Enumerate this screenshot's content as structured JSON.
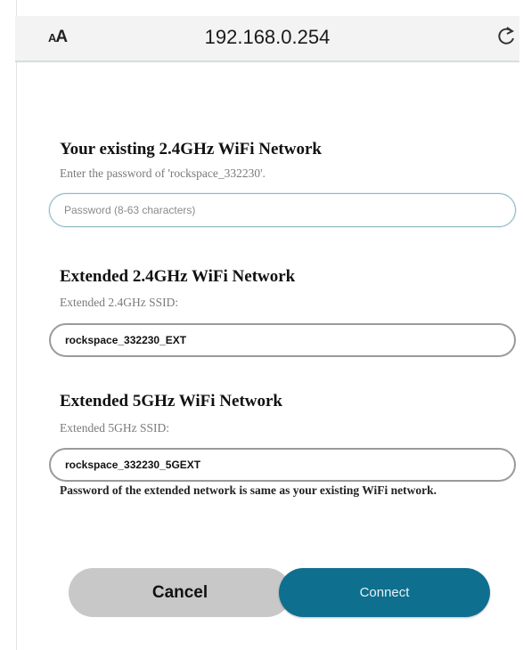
{
  "browser": {
    "text_size_label_small": "A",
    "text_size_label_large": "A",
    "url": "192.168.0.254",
    "reload_icon": "reload-icon"
  },
  "existing_network": {
    "title": "Your existing 2.4GHz WiFi Network",
    "hint": "Enter the password of 'rockspace_332230'.",
    "password_placeholder": "Password (8-63 characters)",
    "password_value": ""
  },
  "extended_24": {
    "title": "Extended 2.4GHz WiFi Network",
    "hint": "Extended 2.4GHz SSID:",
    "ssid_value": "rockspace_332230_EXT"
  },
  "extended_5": {
    "title": "Extended 5GHz WiFi Network",
    "hint": "Extended 5GHz SSID:",
    "ssid_value": "rockspace_332230_5GEXT"
  },
  "note": "Password of the extended network is same as your existing WiFi network.",
  "buttons": {
    "cancel": "Cancel",
    "connect": "Connect"
  },
  "colors": {
    "connect_button": "#0e6f8f",
    "cancel_button": "#c8c8c8"
  }
}
